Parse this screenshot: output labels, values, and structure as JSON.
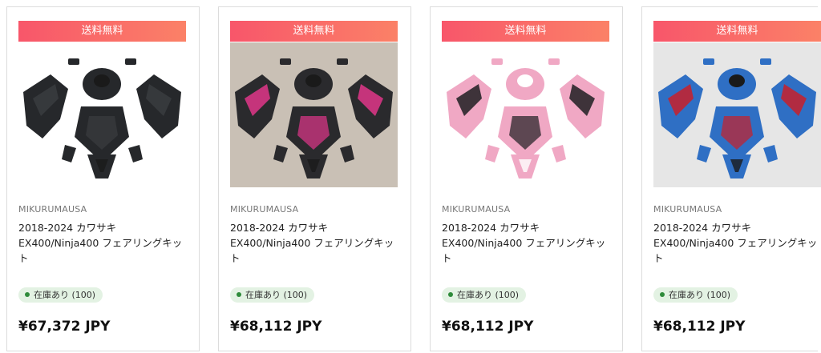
{
  "products": [
    {
      "badge": "送料無料",
      "brand": "MIKURUMAUSA",
      "title": "2018-2024 カワサキ EX400/Ninja400 フェアリングキット",
      "stock": "在庫あり (100)",
      "price": "¥67,372 JPY",
      "colors": {
        "background": "#ffffff",
        "primary": "#26282b",
        "accent": "#3a3c40",
        "trim": "#1a1a1a"
      }
    },
    {
      "badge": "送料無料",
      "brand": "MIKURUMAUSA",
      "title": "2018-2024 カワサキ EX400/Ninja400 フェアリングキット",
      "stock": "在庫あり (100)",
      "price": "¥68,112 JPY",
      "colors": {
        "background": "#c9c0b5",
        "primary": "#2a2a2d",
        "accent": "#e0368a",
        "trim": "#1a1a1a"
      }
    },
    {
      "badge": "送料無料",
      "brand": "MIKURUMAUSA",
      "title": "2018-2024 カワサキ EX400/Ninja400 フェアリングキット",
      "stock": "在庫あり (100)",
      "price": "¥68,112 JPY",
      "colors": {
        "background": "#ffffff",
        "primary": "#f0a8c4",
        "accent": "#1e1e22",
        "trim": "#ffffff"
      }
    },
    {
      "badge": "送料無料",
      "brand": "MIKURUMAUSA",
      "title": "2018-2024 カワサキ EX400/Ninja400 フェアリングキット",
      "stock": "在庫あり (100)",
      "price": "¥68,112 JPY",
      "colors": {
        "background": "#e6e6e6",
        "primary": "#2f6fc4",
        "accent": "#c8202a",
        "trim": "#1a1a1a"
      }
    }
  ]
}
